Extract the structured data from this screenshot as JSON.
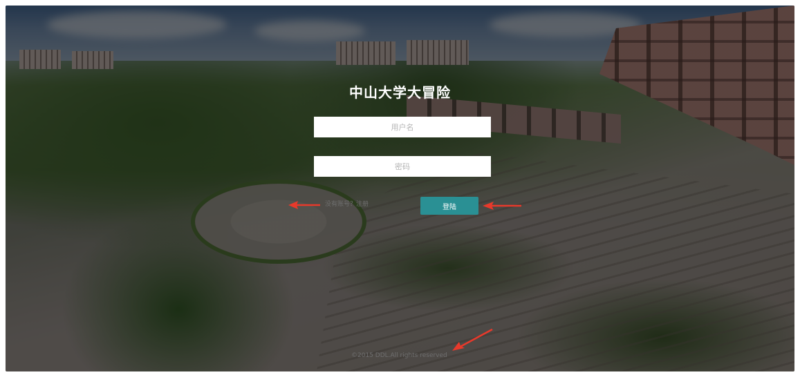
{
  "app": {
    "title": "中山大学大冒险"
  },
  "form": {
    "username_placeholder": "用户名",
    "password_placeholder": "密码",
    "register_link": "没有账号？注册",
    "login_button": "登陆"
  },
  "footer": {
    "copyright": "©2015 DDL.All rights reserved"
  },
  "annotations": {
    "arrow_color": "#e8392b"
  },
  "colors": {
    "button": "#2a9094",
    "overlay": "rgba(0,0,0,0.55)"
  }
}
